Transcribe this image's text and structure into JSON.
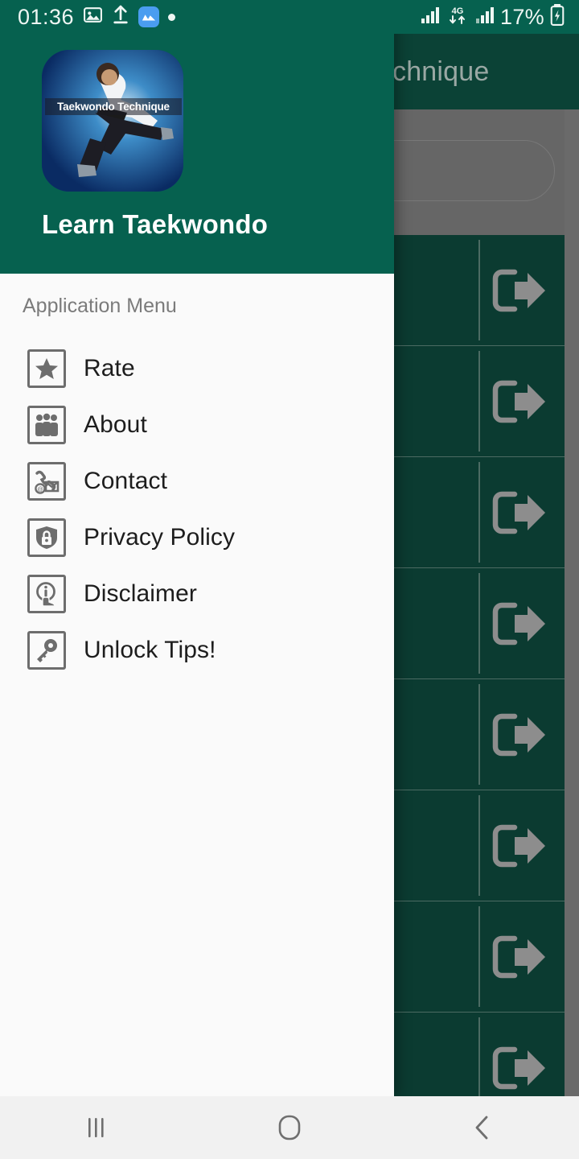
{
  "status_bar": {
    "clock": "01:36",
    "battery_text": "17%",
    "network_label": "4G",
    "icons": [
      "image-icon",
      "upload-icon",
      "blue-app-icon",
      "dot-icon",
      "signal-icon",
      "mobile-data-icon",
      "signal-icon-2",
      "battery-charging-icon"
    ],
    "background_color": "#06614f",
    "text_color": "#eef6f3"
  },
  "drawer": {
    "app_title": "Learn Taekwondo",
    "logo_caption": "Taekwondo Technique",
    "menu_heading": "Application Menu",
    "header_color": "#06614f",
    "body_color": "#fafafa",
    "items": [
      {
        "label": "Rate",
        "icon": "star-icon"
      },
      {
        "label": "About",
        "icon": "people-group-icon"
      },
      {
        "label": "Contact",
        "icon": "phone-envelope-at-icon"
      },
      {
        "label": "Privacy Policy",
        "icon": "shield-lock-icon"
      },
      {
        "label": "Disclaimer",
        "icon": "info-hand-icon"
      },
      {
        "label": "Unlock Tips!",
        "icon": "key-icon"
      }
    ]
  },
  "background_app": {
    "appbar_title": "chnique",
    "appbar_color": "#0b4236",
    "search_band_color": "#666666",
    "row_color": "#0b3b31",
    "row_icon": "exit-arrow-icon",
    "rows": [
      {
        "icon": "exit-arrow-icon"
      },
      {
        "icon": "exit-arrow-icon"
      },
      {
        "icon": "exit-arrow-icon"
      },
      {
        "icon": "exit-arrow-icon"
      },
      {
        "icon": "exit-arrow-icon"
      },
      {
        "icon": "exit-arrow-icon"
      },
      {
        "icon": "exit-arrow-icon"
      },
      {
        "icon": "exit-arrow-icon"
      }
    ]
  },
  "nav_bar": {
    "background_color": "#f1f1f1",
    "buttons": [
      {
        "name": "recents-button",
        "icon": "recents-icon"
      },
      {
        "name": "home-button",
        "icon": "home-icon"
      },
      {
        "name": "back-button",
        "icon": "back-chevron-icon"
      }
    ]
  }
}
